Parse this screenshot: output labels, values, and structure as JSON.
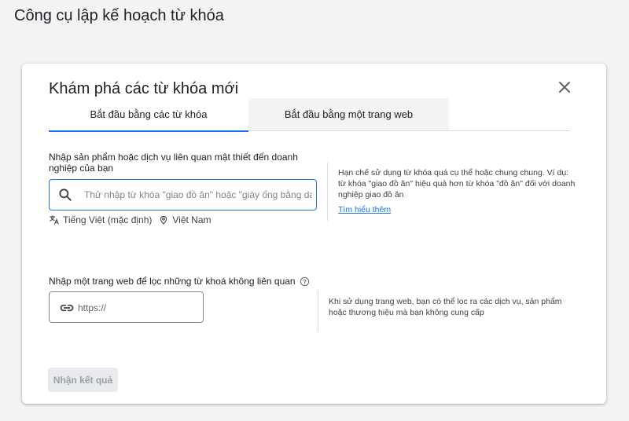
{
  "page": {
    "title": "Công cụ lập kế hoạch từ khóa"
  },
  "dialog": {
    "title": "Khám phá các từ khóa mới",
    "close_icon": "close-icon",
    "tabs": [
      {
        "label": "Bắt đầu bằng các từ khóa",
        "active": true
      },
      {
        "label": "Bắt đầu bằng một trang web",
        "active": false
      }
    ],
    "keywords": {
      "label": "Nhập sản phẩm hoặc dịch vụ liên quan mật thiết đến doanh nghiệp của bạn",
      "search_icon": "search-icon",
      "placeholder": "Thử nhập từ khóa \"giao đồ ăn\" hoặc \"giày ống bằng da\"",
      "value": "",
      "language_icon": "translate-icon",
      "language": "Tiếng Việt (mặc định)",
      "location_icon": "location-pin-icon",
      "location": "Việt Nam",
      "hint": "Hạn chế sử dụng từ khóa quá cụ thể hoặc chung chung. Ví dụ: từ khóa \"giao đồ ăn\" hiệu quả hơn từ khóa \"đồ ăn\" đối với doanh nghiệp giao đồ ăn",
      "learn_more": "Tìm hiểu thêm"
    },
    "website_filter": {
      "label": "Nhập một trang web để lọc những từ khoá không liên quan",
      "help_icon": "help-circle-icon",
      "link_icon": "link-icon",
      "placeholder": "https://",
      "value": "",
      "hint": "Khi sử dụng trang web, bạn có thể lọc ra các dịch vụ, sản phẩm hoặc thương hiệu mà bạn không cung cấp"
    },
    "submit": {
      "label": "Nhận kết quả",
      "disabled": true
    }
  },
  "colors": {
    "accent": "#1a73e8",
    "background": "#f1f3f4",
    "card": "#ffffff",
    "disabled_button": "#e8eaed",
    "disabled_text": "#9aa0a6"
  }
}
